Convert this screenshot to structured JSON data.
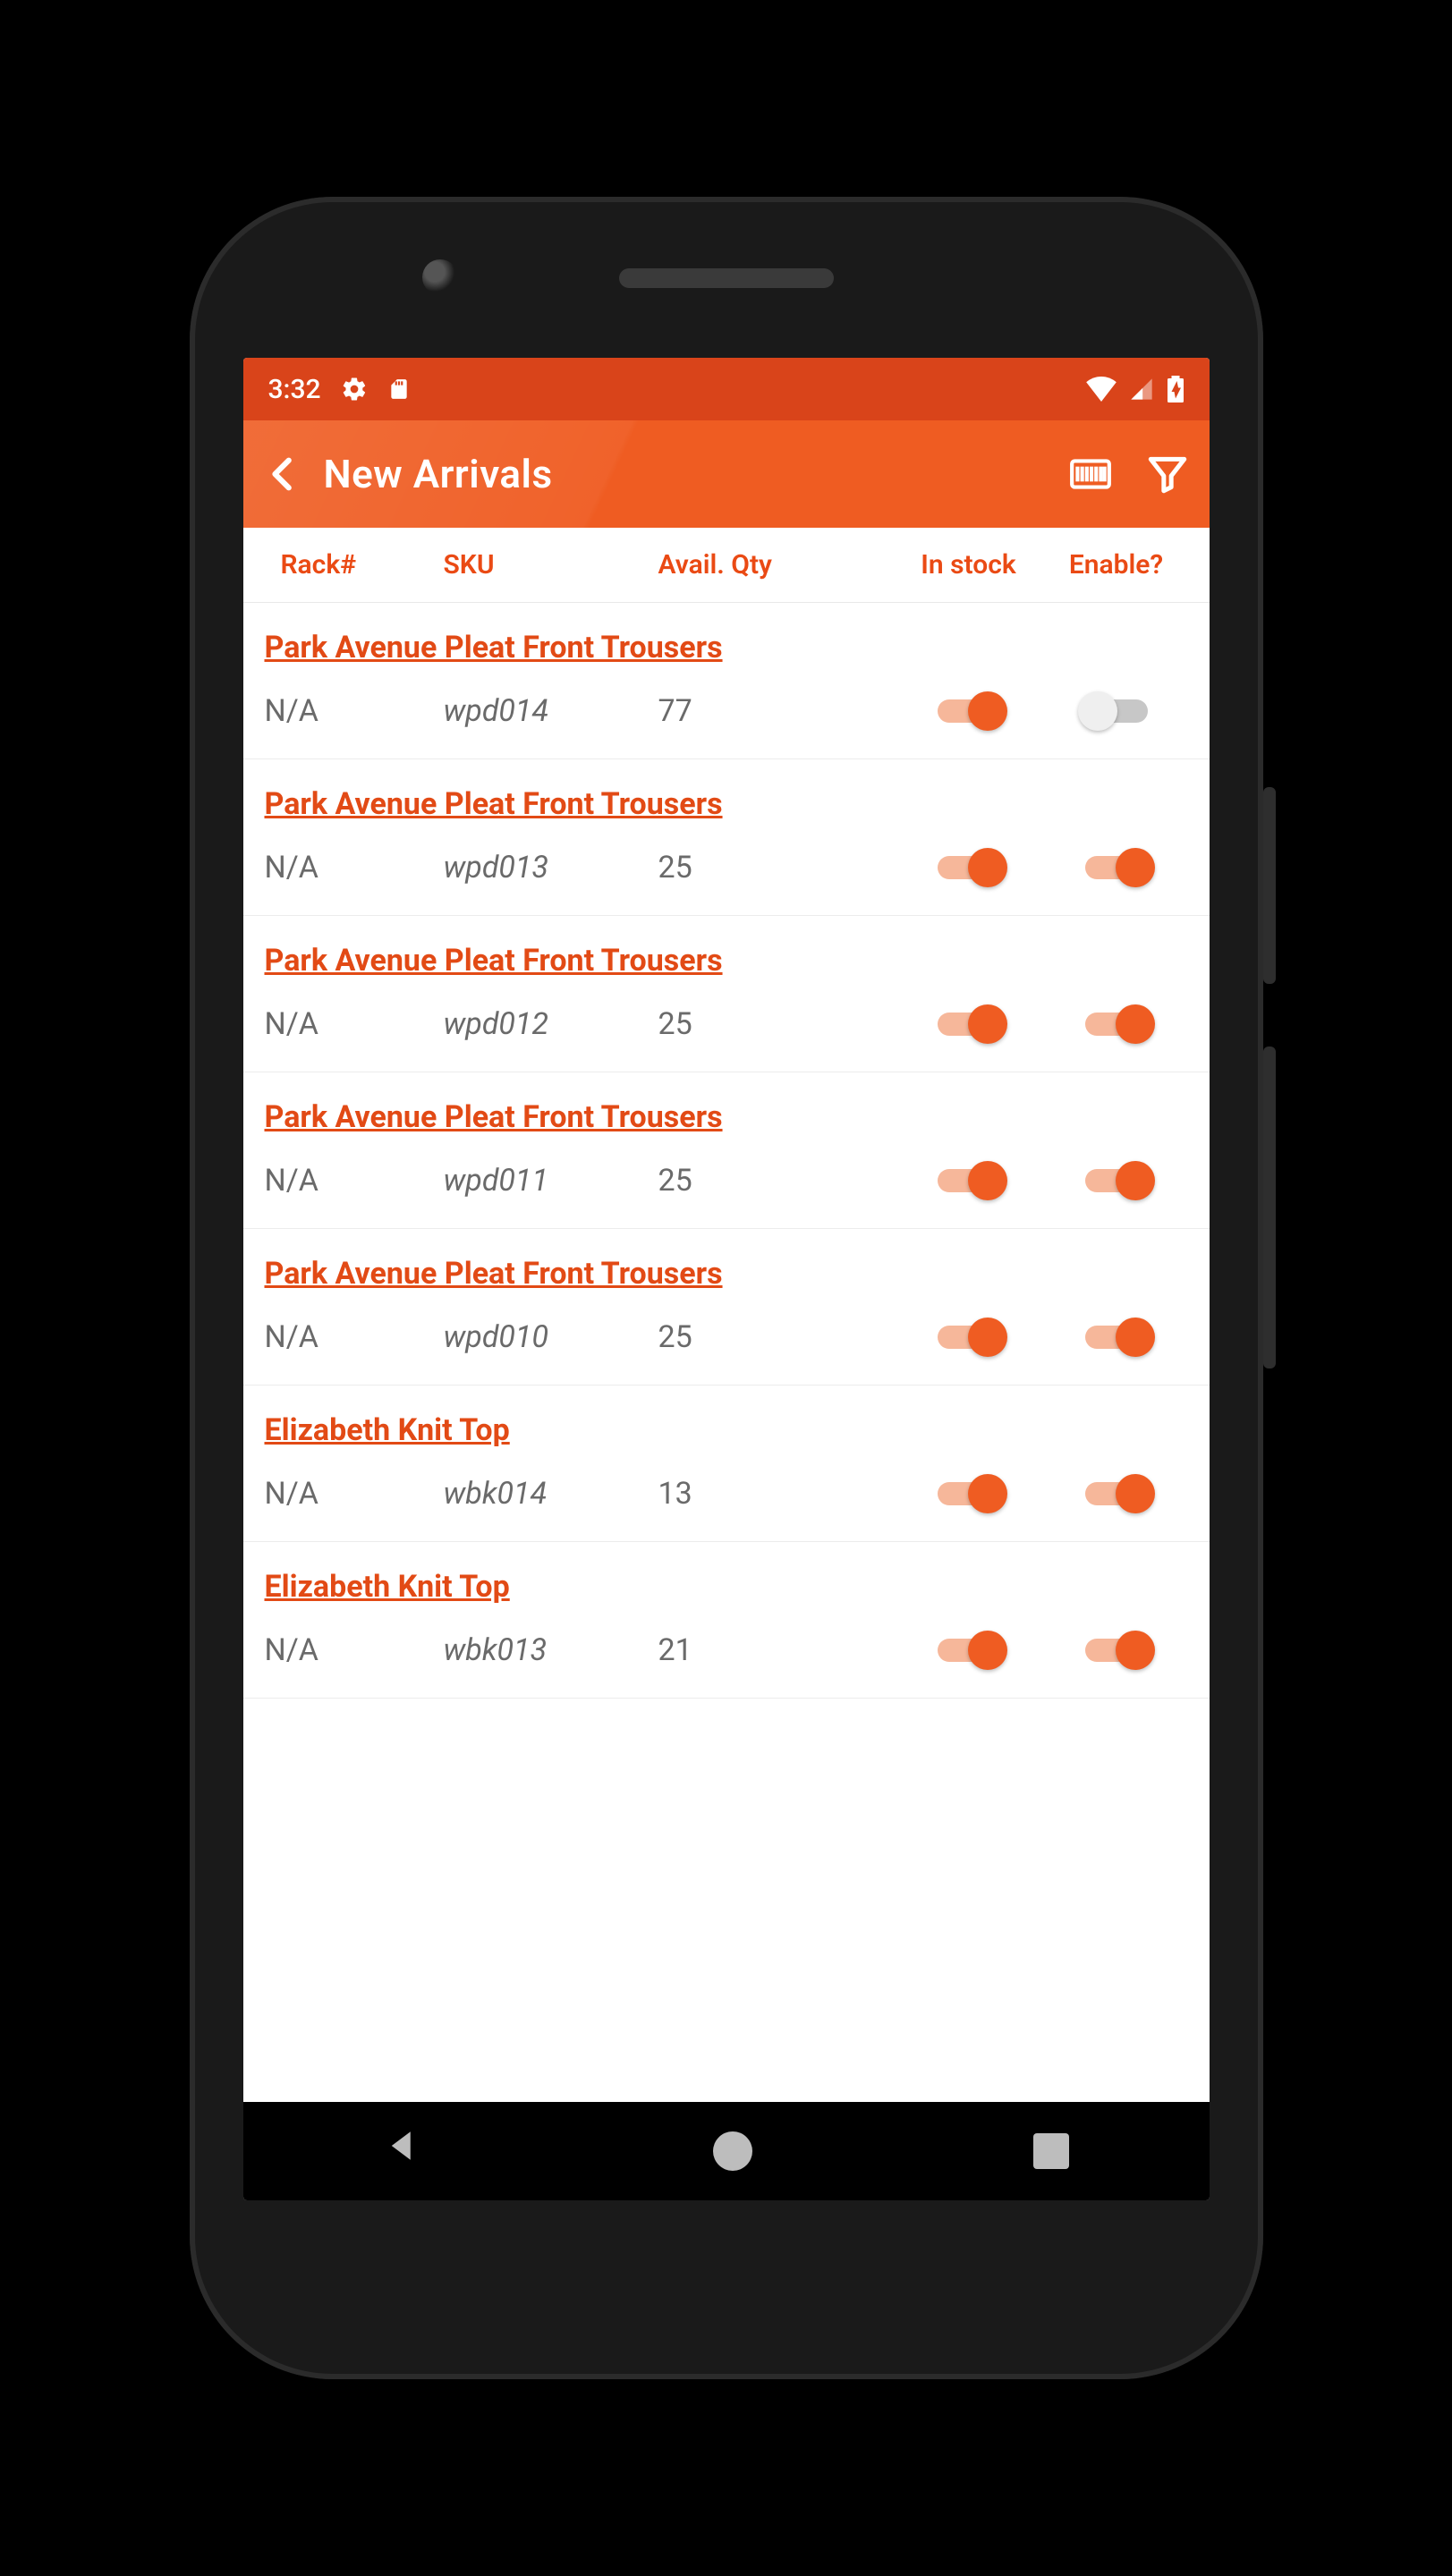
{
  "status": {
    "time": "3:32"
  },
  "appbar": {
    "title": "New Arrivals"
  },
  "columns": {
    "rack": "Rack#",
    "sku": "SKU",
    "qty": "Avail. Qty",
    "stock": "In stock",
    "enable": "Enable?"
  },
  "items": [
    {
      "name": "Park Avenue Pleat Front Trousers",
      "rack": "N/A",
      "sku": "wpd014",
      "qty": "77",
      "in_stock": true,
      "enabled": false
    },
    {
      "name": "Park Avenue Pleat Front Trousers",
      "rack": "N/A",
      "sku": "wpd013",
      "qty": "25",
      "in_stock": true,
      "enabled": true
    },
    {
      "name": "Park Avenue Pleat Front Trousers",
      "rack": "N/A",
      "sku": "wpd012",
      "qty": "25",
      "in_stock": true,
      "enabled": true
    },
    {
      "name": "Park Avenue Pleat Front Trousers",
      "rack": "N/A",
      "sku": "wpd011",
      "qty": "25",
      "in_stock": true,
      "enabled": true
    },
    {
      "name": "Park Avenue Pleat Front Trousers",
      "rack": "N/A",
      "sku": "wpd010",
      "qty": "25",
      "in_stock": true,
      "enabled": true
    },
    {
      "name": "Elizabeth Knit Top",
      "rack": "N/A",
      "sku": "wbk014",
      "qty": "13",
      "in_stock": true,
      "enabled": true
    },
    {
      "name": "Elizabeth Knit Top",
      "rack": "N/A",
      "sku": "wbk013",
      "qty": "21",
      "in_stock": true,
      "enabled": true
    }
  ]
}
